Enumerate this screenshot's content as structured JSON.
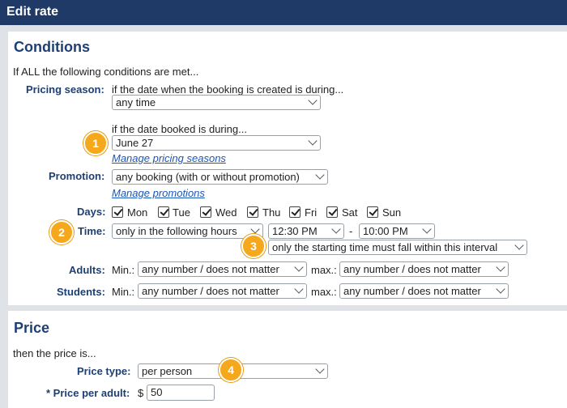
{
  "window": {
    "title": "Edit rate"
  },
  "conditions": {
    "heading": "Conditions",
    "intro": "If ALL the following conditions are met...",
    "pricing_season": {
      "label": "Pricing season:",
      "created_text": "if the date when the booking is created is during...",
      "created_value": "any time",
      "booked_text": "if the date booked is during...",
      "booked_value": "June 27",
      "manage_link": "Manage pricing seasons"
    },
    "promotion": {
      "label": "Promotion:",
      "value": "any booking (with or without promotion)",
      "manage_link": "Manage promotions"
    },
    "days": {
      "label": "Days:",
      "items": [
        {
          "label": "Mon",
          "checked": true
        },
        {
          "label": "Tue",
          "checked": true
        },
        {
          "label": "Wed",
          "checked": true
        },
        {
          "label": "Thu",
          "checked": true
        },
        {
          "label": "Fri",
          "checked": true
        },
        {
          "label": "Sat",
          "checked": true
        },
        {
          "label": "Sun",
          "checked": true
        }
      ]
    },
    "time": {
      "label": "Time:",
      "mode": "only in the following hours",
      "start": "12:30 PM",
      "separator": "-",
      "end": "10:00 PM",
      "interval_rule": "only the starting time must fall within this interval"
    },
    "adults": {
      "label": "Adults:",
      "min_label": "Min.:",
      "min_value": "any number / does not matter",
      "max_label": "max.:",
      "max_value": "any number / does not matter"
    },
    "students": {
      "label": "Students:",
      "min_label": "Min.:",
      "min_value": "any number / does not matter",
      "max_label": "max.:",
      "max_value": "any number / does not matter"
    }
  },
  "price": {
    "heading": "Price",
    "intro": "then the price is...",
    "type": {
      "label": "Price type:",
      "value": "per person"
    },
    "per_adult": {
      "label": "* Price per adult:",
      "currency": "$",
      "value": "50"
    }
  },
  "badges": [
    "1",
    "2",
    "3",
    "4"
  ],
  "colors": {
    "titlebar": "#1f3a66",
    "heading": "#1e3f73",
    "link": "#1a56b8",
    "badge": "#f5a81c"
  }
}
